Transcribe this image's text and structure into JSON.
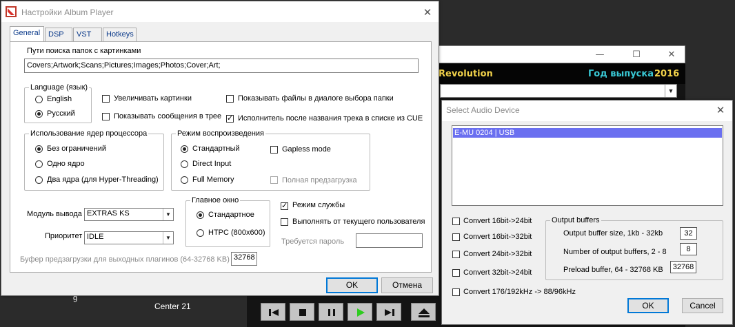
{
  "player": {
    "album_suffix": "Revolution",
    "year_label": "Год выпуска",
    "year_value": "2016",
    "track_text": "Center 21",
    "bg_fragment": "g",
    "controls": [
      "prev-icon",
      "stop-icon",
      "pause-icon",
      "play-icon",
      "next-icon",
      "eject-icon"
    ],
    "play_color": "#2ecc1f"
  },
  "settings": {
    "title": "Настройки Album Player",
    "tabs": [
      "General",
      "DSP",
      "VST",
      "Hotkeys"
    ],
    "search_paths_label": "Пути поиска папок с картинками",
    "search_paths_value": "Covers;Artwork;Scans;Pictures;Images;Photos;Cover;Art;",
    "language_group": "Language (язык)",
    "lang_english": "English",
    "lang_russian": "Русский",
    "enlarge_images": "Увеличивать картинки",
    "show_files_dialog": "Показывать файлы в диалоге выбора папки",
    "show_tree_messages": "Показывать сообщения в трее",
    "artist_after_title": "Исполнитель после названия трека в списке из CUE",
    "cpu_group": "Использование ядер процессора",
    "cpu_unlimited": "Без ограничений",
    "cpu_one": "Одно ядро",
    "cpu_two": "Два ядра (для Hyper-Threading)",
    "playback_group": "Режим воспроизведения",
    "pb_standard": "Стандартный",
    "pb_direct": "Direct Input",
    "pb_full": "Full Memory",
    "gapless": "Gapless mode",
    "full_preload": "Полная предзагрузка",
    "main_window_group": "Главное окно",
    "mw_standard": "Стандартное",
    "mw_htpc": "HTPC (800x600)",
    "output_module_label": "Модуль вывода",
    "output_module_value": "EXTRAS KS",
    "priority_label": "Приоритет",
    "priority_value": "IDLE",
    "service_mode": "Режим службы",
    "run_as_current_user": "Выполнять от текущего пользователя",
    "password_label": "Требуется пароль",
    "password_value": "",
    "buffer_label": "Буфер предзагрузки для выходных плагинов (64-32768 KB)",
    "buffer_value": "32768",
    "ok": "OK",
    "cancel": "Отмена"
  },
  "audio": {
    "title": "Select Audio Device",
    "device": "E-MU 0204 | USB",
    "convert_16_24": "Convert 16bit->24bit",
    "convert_16_32": "Convert 16bit->32bit",
    "convert_24_32": "Convert 24bit->32bit",
    "convert_32_24": "Convert 32bit->24bit",
    "convert_rate": "Convert 176/192kHz -> 88/96kHz",
    "buffers_group": "Output buffers",
    "buffer_size_label": "Output buffer size, 1kb - 32kb",
    "buffer_size_value": "32",
    "buffer_count_label": "Number of output buffers, 2 - 8",
    "buffer_count_value": "8",
    "preload_label": "Preload buffer, 64 - 32768 KB",
    "preload_value": "32768",
    "ok": "OK",
    "cancel": "Cancel"
  }
}
